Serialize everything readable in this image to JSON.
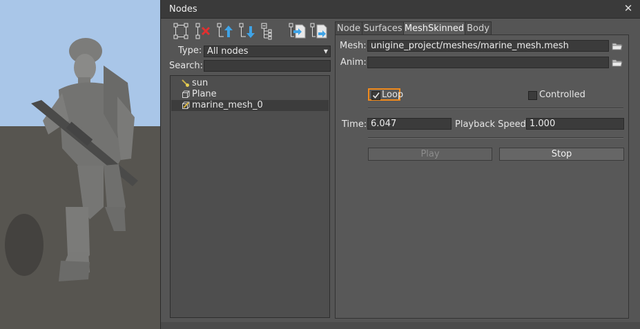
{
  "window": {
    "title": "Nodes"
  },
  "left": {
    "type_label": "Type:",
    "type_value": "All nodes",
    "search_label": "Search:",
    "search_value": "",
    "tree": [
      {
        "label": "sun",
        "icon": "light-icon",
        "selected": false
      },
      {
        "label": "Plane",
        "icon": "mesh-icon",
        "selected": false
      },
      {
        "label": "marine_mesh_0",
        "icon": "skinned-mesh-icon",
        "selected": true
      }
    ]
  },
  "tabs": [
    {
      "label": "Node",
      "active": false
    },
    {
      "label": "Surfaces",
      "active": false
    },
    {
      "label": "MeshSkinned",
      "active": true
    },
    {
      "label": "Body",
      "active": false
    }
  ],
  "mesh": {
    "mesh_label": "Mesh:",
    "mesh_value": "unigine_project/meshes/marine_mesh.mesh",
    "anim_label": "Anim:",
    "anim_value": "",
    "loop_label": "Loop",
    "loop_checked": true,
    "controlled_label": "Controlled",
    "controlled_checked": false,
    "time_label": "Time:",
    "time_value": "6.047",
    "speed_label": "Playback Speed:",
    "speed_value": "1.000",
    "play_label": "Play",
    "stop_label": "Stop"
  },
  "colors": {
    "highlight": "#f08a1c",
    "sky": "#a9c6e8",
    "ground": "#575550"
  }
}
